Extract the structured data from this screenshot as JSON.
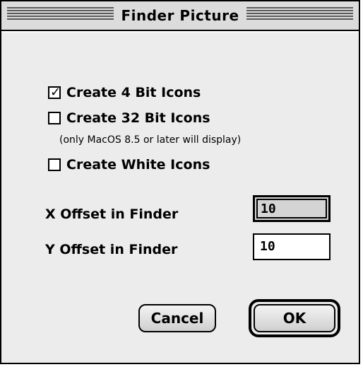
{
  "window": {
    "title": "Finder Picture"
  },
  "options": [
    {
      "label": "Create 4 Bit Icons",
      "checked": true
    },
    {
      "label": "Create 32 Bit Icons",
      "checked": false
    },
    {
      "label": "Create White Icons",
      "checked": false
    }
  ],
  "note": "(only MacOS 8.5 or later will display)",
  "fields": {
    "x_label": "X Offset in Finder",
    "x_value": "10",
    "y_label": "Y Offset in Finder",
    "y_value": "10"
  },
  "buttons": {
    "cancel": "Cancel",
    "ok": "OK"
  }
}
